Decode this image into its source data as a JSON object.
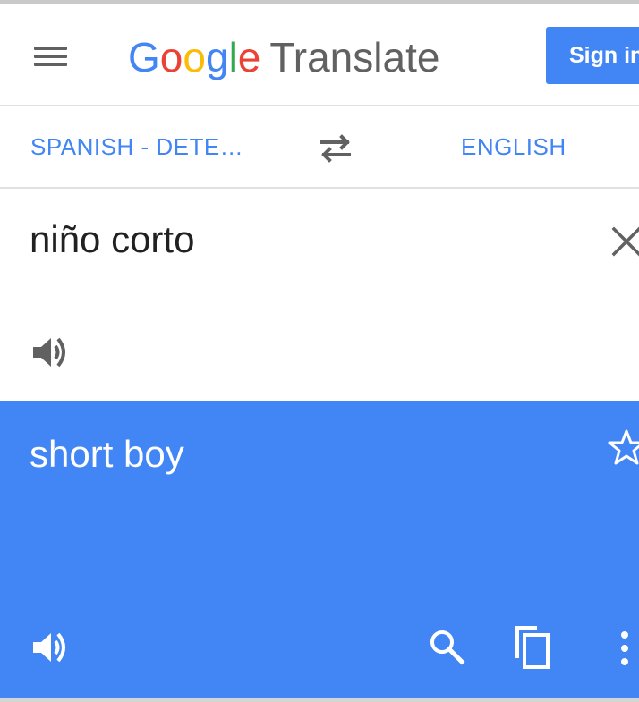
{
  "header": {
    "logo": {
      "g1": "G",
      "g2": "o",
      "g3": "o",
      "g4": "g",
      "g5": "l",
      "g6": "e",
      "product": "Translate"
    },
    "sign_in": "Sign in"
  },
  "languages": {
    "source": "SPANISH - DETE…",
    "target": "ENGLISH"
  },
  "input": {
    "text": "niño corto"
  },
  "result": {
    "text": "short boy"
  },
  "icons": [
    "menu-icon",
    "swap-languages-icon",
    "clear-icon",
    "speaker-icon",
    "star-icon",
    "search-icon",
    "copy-icon",
    "more-vert-icon"
  ],
  "colors": {
    "accent": "#4285f4",
    "icon_gray": "#616161",
    "text": "#212121"
  }
}
